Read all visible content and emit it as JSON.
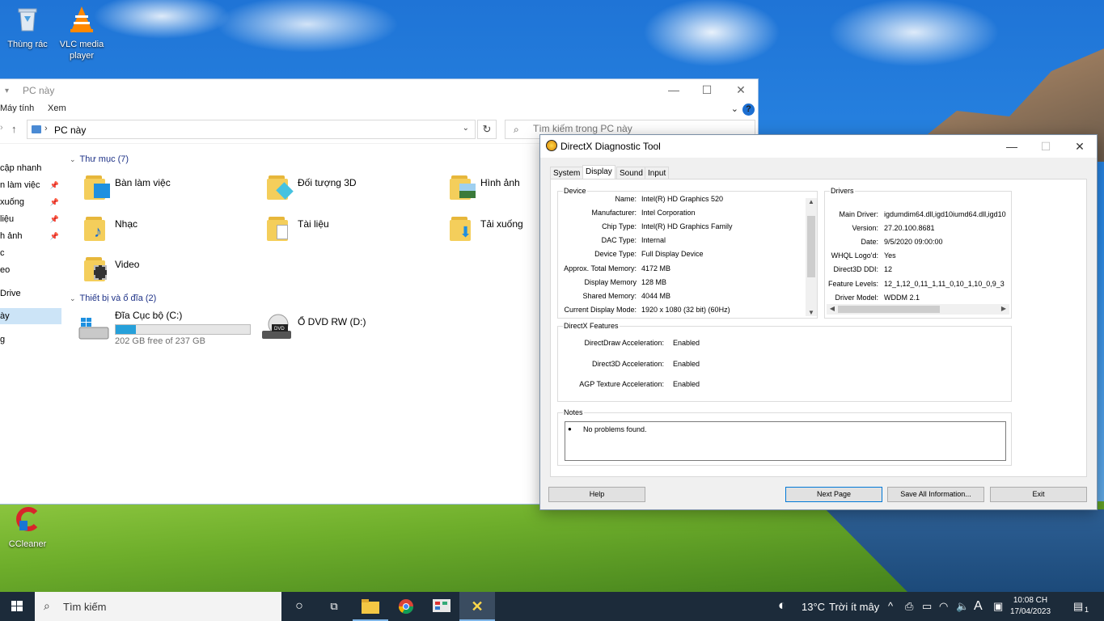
{
  "desktop": {
    "icons": [
      {
        "label": "Thùng rác",
        "icon": "recycle-bin-icon"
      },
      {
        "label": "VLC media player",
        "icon": "vlc-icon"
      },
      {
        "label": "CCleaner",
        "icon": "ccleaner-icon"
      }
    ]
  },
  "explorer": {
    "title": "PC này",
    "ribbon_tabs": [
      "Máy tính",
      "Xem"
    ],
    "address": "PC này",
    "search_placeholder": "Tìm kiếm trong PC này",
    "nav_items": [
      {
        "label": "cập nhanh",
        "pinned": false
      },
      {
        "label": "n làm việc",
        "pinned": true
      },
      {
        "label": " xuống",
        "pinned": true
      },
      {
        "label": "liệu",
        "pinned": true
      },
      {
        "label": "h ảnh",
        "pinned": true
      },
      {
        "label": "c",
        "pinned": false
      },
      {
        "label": "eo",
        "pinned": false
      },
      {
        "label": "Drive",
        "pinned": false
      },
      {
        "label": "ày",
        "pinned": false,
        "selected": true
      },
      {
        "label": "g",
        "pinned": false
      }
    ],
    "folders_header": "Thư mục (7)",
    "folders": [
      {
        "name": "Bàn làm việc",
        "icon": "desktop-folder-icon"
      },
      {
        "name": "Đối tượng 3D",
        "icon": "3d-objects-folder-icon"
      },
      {
        "name": "Hình ảnh",
        "icon": "pictures-folder-icon"
      },
      {
        "name": "Nhạc",
        "icon": "music-folder-icon"
      },
      {
        "name": "Tài liệu",
        "icon": "documents-folder-icon"
      },
      {
        "name": "Tải xuống",
        "icon": "downloads-folder-icon"
      },
      {
        "name": "Video",
        "icon": "videos-folder-icon"
      }
    ],
    "devices_header": "Thiết bị và ổ đĩa (2)",
    "drives": [
      {
        "name": "Đĩa Cục bộ (C:)",
        "free_text": "202 GB free of 237 GB",
        "used_fraction": 0.148,
        "icon": "local-disk-icon"
      },
      {
        "name": "Ổ DVD RW (D:)",
        "icon": "dvd-drive-icon"
      }
    ]
  },
  "dxdiag": {
    "title": "DirectX Diagnostic Tool",
    "tabs": [
      "System",
      "Display",
      "Sound",
      "Input"
    ],
    "active_tab": "Display",
    "device_legend": "Device",
    "device": [
      {
        "k": "Name:",
        "v": "Intel(R) HD Graphics 520"
      },
      {
        "k": "Manufacturer:",
        "v": "Intel Corporation"
      },
      {
        "k": "Chip Type:",
        "v": "Intel(R) HD Graphics Family"
      },
      {
        "k": "DAC Type:",
        "v": "Internal"
      },
      {
        "k": "Device Type:",
        "v": "Full Display Device"
      },
      {
        "k": "Approx. Total Memory:",
        "v": "4172 MB"
      },
      {
        "k": "Display Memory",
        "v": "128 MB"
      },
      {
        "k": "Shared Memory:",
        "v": "4044 MB"
      },
      {
        "k": "Current Display Mode:",
        "v": "1920 x 1080 (32 bit) (60Hz)"
      }
    ],
    "drivers_legend": "Drivers",
    "drivers": [
      {
        "k": "Main Driver:",
        "v": "igdumdim64.dll,igd10iumd64.dll,igd10"
      },
      {
        "k": "Version:",
        "v": "27.20.100.8681"
      },
      {
        "k": "Date:",
        "v": "9/5/2020 09:00:00"
      },
      {
        "k": "WHQL Logo'd:",
        "v": "Yes"
      },
      {
        "k": "Direct3D DDI:",
        "v": "12"
      },
      {
        "k": "Feature Levels:",
        "v": "12_1,12_0,11_1,11_0,10_1,10_0,9_3"
      },
      {
        "k": "Driver Model:",
        "v": "WDDM 2.1"
      }
    ],
    "features_legend": "DirectX Features",
    "features": [
      {
        "k": "DirectDraw Acceleration:",
        "v": "Enabled"
      },
      {
        "k": "Direct3D Acceleration:",
        "v": "Enabled"
      },
      {
        "k": "AGP Texture Acceleration:",
        "v": "Enabled"
      }
    ],
    "notes_legend": "Notes",
    "notes": "No problems found.",
    "buttons": {
      "help": "Help",
      "next": "Next Page",
      "save": "Save All Information...",
      "exit": "Exit"
    }
  },
  "taskbar": {
    "search_label": "Tìm kiếm",
    "weather_temp": "13°C",
    "weather_desc": "Trời ít mây",
    "ime": "A",
    "time": "10:08 CH",
    "date": "17/04/2023",
    "notification_count": "1"
  }
}
